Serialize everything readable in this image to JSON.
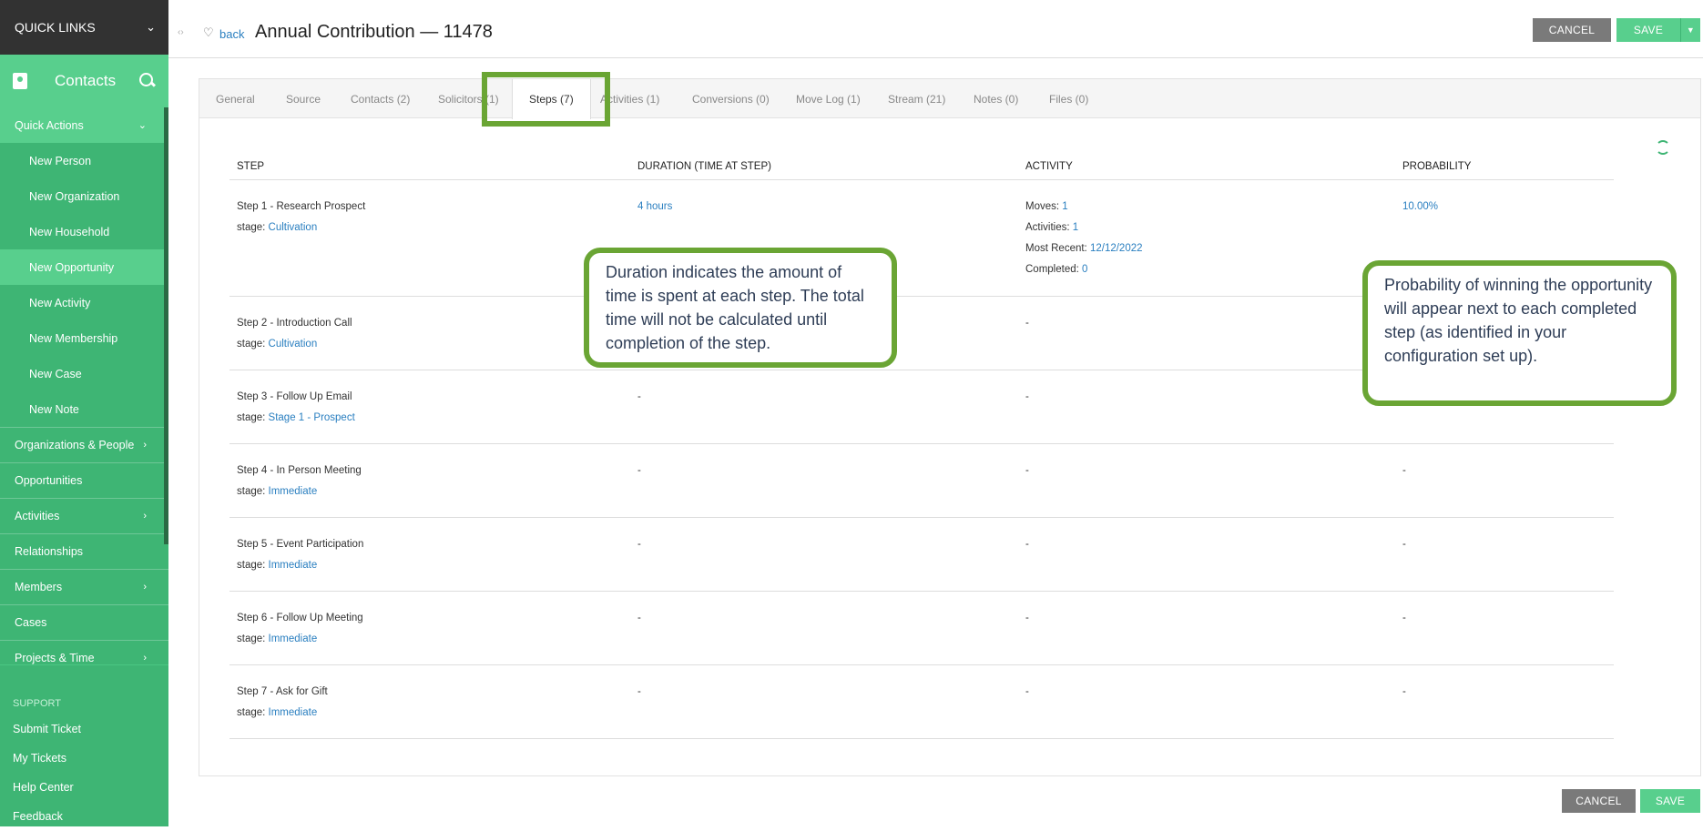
{
  "sidebar": {
    "quick_links": "QUICK LINKS",
    "module": "Contacts",
    "quick_actions": "Quick Actions",
    "actions": [
      "New Person",
      "New Organization",
      "New Household",
      "New Opportunity",
      "New Activity",
      "New Membership",
      "New Case",
      "New Note"
    ],
    "nav": [
      {
        "label": "Organizations & People",
        "arrow": "›"
      },
      {
        "label": "Opportunities",
        "arrow": ""
      },
      {
        "label": "Activities",
        "arrow": "›"
      },
      {
        "label": "Relationships",
        "arrow": ""
      },
      {
        "label": "Members",
        "arrow": "›"
      },
      {
        "label": "Cases",
        "arrow": ""
      },
      {
        "label": "Projects & Time",
        "arrow": "›"
      }
    ],
    "support_label": "SUPPORT",
    "support_links": [
      "Submit Ticket",
      "My Tickets",
      "Help Center",
      "Feedback"
    ]
  },
  "header": {
    "back": "back",
    "title": "Annual Contribution — 11478",
    "cancel": "CANCEL",
    "save": "SAVE"
  },
  "tabs": [
    "General",
    "Source",
    "Contacts (2)",
    "Solicitors (1)",
    "Steps (7)",
    "Activities (1)",
    "Conversions (0)",
    "Move Log (1)",
    "Stream (21)",
    "Notes (0)",
    "Files (0)"
  ],
  "active_tab": "Steps (7)",
  "table": {
    "headers": [
      "STEP",
      "DURATION (TIME AT STEP)",
      "ACTIVITY",
      "PROBABILITY"
    ],
    "stage_prefix": "stage:",
    "rows": [
      {
        "step": "Step 1 - Research Prospect",
        "stage": "Cultivation",
        "duration": "4 hours",
        "activity": [
          {
            "k": "Moves:",
            "v": "1"
          },
          {
            "k": "Activities:",
            "v": "1"
          },
          {
            "k": "Most Recent:",
            "v": "12/12/2022"
          },
          {
            "k": "Completed:",
            "v": "0"
          }
        ],
        "probability": "10.00%"
      },
      {
        "step": "Step 2 - Introduction Call",
        "stage": "Cultivation",
        "duration": "",
        "activity_text": "-",
        "probability": ""
      },
      {
        "step": "Step 3 - Follow Up Email",
        "stage": "Stage 1 - Prospect",
        "duration": "-",
        "activity_text": "-",
        "probability": "-"
      },
      {
        "step": "Step 4 - In Person Meeting",
        "stage": "Immediate",
        "duration": "-",
        "activity_text": "-",
        "probability": "-"
      },
      {
        "step": "Step 5 - Event Participation",
        "stage": "Immediate",
        "duration": "-",
        "activity_text": "-",
        "probability": "-"
      },
      {
        "step": "Step 6 - Follow Up Meeting",
        "stage": "Immediate",
        "duration": "-",
        "activity_text": "-",
        "probability": "-"
      },
      {
        "step": "Step 7 - Ask for Gift",
        "stage": "Immediate",
        "duration": "-",
        "activity_text": "-",
        "probability": "-"
      }
    ]
  },
  "callouts": {
    "duration": "Duration indicates the amount of time is spent at each step. The total time will not be calculated until completion of the step.",
    "probability": "Probability of winning the opportunity will appear next to each completed step (as identified in your configuration set up)."
  },
  "footer": {
    "cancel": "CANCEL",
    "save": "SAVE"
  },
  "colors": {
    "accent": "#3eb574",
    "accent_light": "#58cf8d",
    "highlight": "#6aa534",
    "link": "#2a7fc0"
  }
}
